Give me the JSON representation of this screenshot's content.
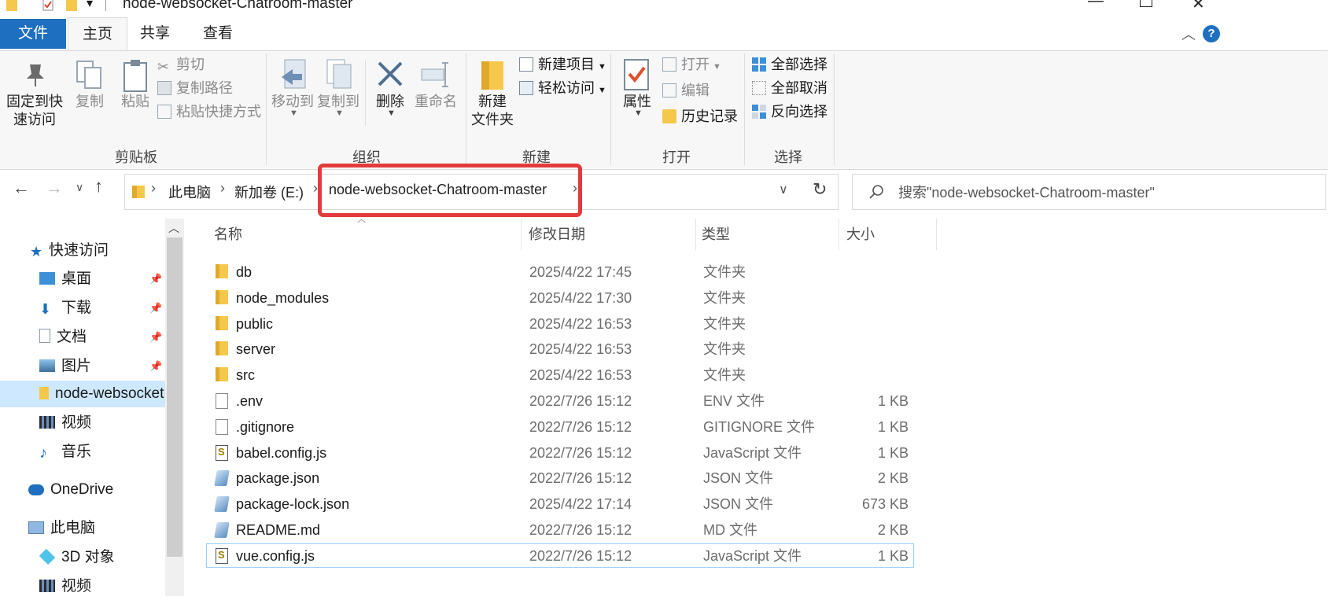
{
  "window": {
    "title": "node-websocket-Chatroom-master"
  },
  "tabs": {
    "file": "文件",
    "home": "主页",
    "share": "共享",
    "view": "查看"
  },
  "ribbon": {
    "clipboard": {
      "pin_label_1": "固定到快",
      "pin_label_2": "速访问",
      "copy": "复制",
      "paste": "粘贴",
      "cut": "剪切",
      "copy_path": "复制路径",
      "paste_shortcut": "粘贴快捷方式",
      "group": "剪贴板"
    },
    "organize": {
      "move_to": "移动到",
      "copy_to": "复制到",
      "delete": "删除",
      "rename": "重命名",
      "group": "组织"
    },
    "new": {
      "new_folder_1": "新建",
      "new_folder_2": "文件夹",
      "new_item": "新建项目",
      "easy_access": "轻松访问",
      "group": "新建"
    },
    "open": {
      "properties": "属性",
      "open": "打开",
      "edit": "编辑",
      "history": "历史记录",
      "group": "打开"
    },
    "select": {
      "select_all": "全部选择",
      "select_none": "全部取消",
      "invert": "反向选择",
      "group": "选择"
    }
  },
  "address": {
    "crumbs": [
      "此电脑",
      "新加卷 (E:)",
      "node-websocket-Chatroom-master"
    ],
    "search_placeholder": "搜索\"node-websocket-Chatroom-master\""
  },
  "nav": {
    "quick_access": "快速访问",
    "items": [
      {
        "label": "桌面",
        "icon": "desktop-icon",
        "pinned": true
      },
      {
        "label": "下载",
        "icon": "download-icon",
        "pinned": true
      },
      {
        "label": "文档",
        "icon": "document-icon",
        "pinned": true
      },
      {
        "label": "图片",
        "icon": "picture-icon",
        "pinned": true
      },
      {
        "label": "node-websocket",
        "icon": "folder-icon",
        "pinned": false
      },
      {
        "label": "视频",
        "icon": "video-icon",
        "pinned": false
      },
      {
        "label": "音乐",
        "icon": "music-icon",
        "pinned": false
      }
    ],
    "onedrive": "OneDrive",
    "this_pc": "此电脑",
    "pc_items": [
      {
        "label": "3D 对象",
        "icon": "3d-objects-icon"
      },
      {
        "label": "视频",
        "icon": "video-icon"
      }
    ]
  },
  "columns": {
    "name": "名称",
    "date": "修改日期",
    "type": "类型",
    "size": "大小"
  },
  "files": [
    {
      "name": "db",
      "date": "2025/4/22 17:45",
      "type": "文件夹",
      "size": "",
      "icon": "folder-icon"
    },
    {
      "name": "node_modules",
      "date": "2025/4/22 17:30",
      "type": "文件夹",
      "size": "",
      "icon": "folder-icon"
    },
    {
      "name": "public",
      "date": "2025/4/22 16:53",
      "type": "文件夹",
      "size": "",
      "icon": "folder-icon"
    },
    {
      "name": "server",
      "date": "2025/4/22 16:53",
      "type": "文件夹",
      "size": "",
      "icon": "folder-icon"
    },
    {
      "name": "src",
      "date": "2025/4/22 16:53",
      "type": "文件夹",
      "size": "",
      "icon": "folder-icon"
    },
    {
      "name": ".env",
      "date": "2022/7/26 15:12",
      "type": "ENV 文件",
      "size": "1 KB",
      "icon": "file-icon"
    },
    {
      "name": ".gitignore",
      "date": "2022/7/26 15:12",
      "type": "GITIGNORE 文件",
      "size": "1 KB",
      "icon": "file-icon"
    },
    {
      "name": "babel.config.js",
      "date": "2022/7/26 15:12",
      "type": "JavaScript 文件",
      "size": "1 KB",
      "icon": "js-file-icon"
    },
    {
      "name": "package.json",
      "date": "2022/7/26 15:12",
      "type": "JSON 文件",
      "size": "2 KB",
      "icon": "json-file-icon"
    },
    {
      "name": "package-lock.json",
      "date": "2025/4/22 17:14",
      "type": "JSON 文件",
      "size": "673 KB",
      "icon": "json-file-icon"
    },
    {
      "name": "README.md",
      "date": "2022/7/26 15:12",
      "type": "MD 文件",
      "size": "2 KB",
      "icon": "json-file-icon"
    },
    {
      "name": "vue.config.js",
      "date": "2022/7/26 15:12",
      "type": "JavaScript 文件",
      "size": "1 KB",
      "icon": "js-file-icon"
    }
  ],
  "colors": {
    "accent": "#1e6fbf",
    "highlight_box": "#e33b3b",
    "folder": "#f5c84c",
    "selection": "#cde8ff"
  }
}
